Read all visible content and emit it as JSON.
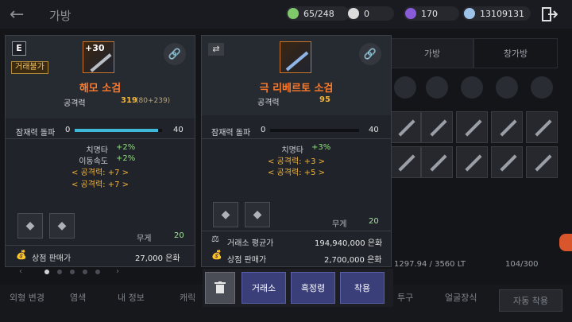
{
  "topbar": {
    "title": "가방",
    "resources": [
      {
        "name": "weight",
        "value": "65/248",
        "color": "#7fc96b"
      },
      {
        "name": "pearl",
        "value": "0",
        "color": "#dcdcdc"
      },
      {
        "name": "shard",
        "value": "170",
        "color": "#8a5bd8"
      },
      {
        "name": "silver",
        "value": "13109131",
        "color": "#9fc3e8"
      }
    ]
  },
  "background": {
    "tab_bag": "가방",
    "tab_warehouse": "창가방",
    "weight_info": "1297.94 / 3560 LT",
    "slot_count": "104/300",
    "bottom_tabs": [
      "외형 변경",
      "염색",
      "내 정보",
      "캐릭",
      "투구",
      "얼굴장식",
      "자동 착용"
    ]
  },
  "card_left": {
    "badge_e": "E",
    "tag": "거래불가",
    "item_level": "+30",
    "name": "해모 소검",
    "attack_label": "공격력",
    "attack_value": "319",
    "attack_detail": "(80+239)",
    "awaken_label": "잠재력 돌파",
    "awaken_min": "0",
    "awaken_max": "40",
    "awaken_fill": 0.95,
    "stats": [
      {
        "label": "치명타",
        "value": "+2%"
      },
      {
        "label": "이동속도",
        "value": "+2%"
      }
    ],
    "bonus": [
      "< 공격력: +7 >",
      "< 공격력: +7 >"
    ],
    "weight_label": "무게",
    "weight_value": "20",
    "sell_label": "상점 판매가",
    "sell_value": "27,000 은화"
  },
  "card_right": {
    "name": "극 리베르토 소검",
    "attack_label": "공격력",
    "attack_value": "95",
    "awaken_label": "잠재력 돌파",
    "awaken_min": "0",
    "awaken_max": "40",
    "awaken_fill": 0.0,
    "stats": [
      {
        "label": "치명타",
        "value": "+3%"
      }
    ],
    "bonus": [
      "< 공격력: +3 >",
      "< 공격력: +5 >"
    ],
    "weight_label": "무게",
    "weight_value": "20",
    "market_label": "거래소 평균가",
    "market_value": "194,940,000 은화",
    "sell_label": "상점 판매가",
    "sell_value": "2,700,000 은화"
  },
  "actions": {
    "market": "거래소",
    "refine": "흑정령",
    "equip": "착용"
  }
}
